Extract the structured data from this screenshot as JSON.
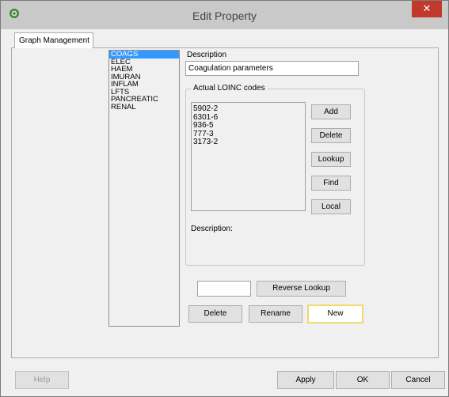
{
  "window": {
    "title": "Edit Property",
    "close_glyph": "✕"
  },
  "tab": {
    "label": "Graph Management"
  },
  "groups": {
    "items": [
      "COAGS",
      "ELEC",
      "HAEM",
      "IMURAN",
      "INFLAM",
      "LFTS",
      "PANCREATIC",
      "RENAL"
    ],
    "selected": "COAGS"
  },
  "description": {
    "label": "Description",
    "value": "Coagulation parameters"
  },
  "loinc": {
    "group_title": "Actual LOINC codes",
    "codes": [
      "5902-2",
      "6301-6",
      "936-5",
      "777-3",
      "3173-2"
    ],
    "buttons": {
      "add": "Add",
      "delete": "Delete",
      "lookup": "Lookup",
      "find": "Find",
      "local": "Local"
    },
    "description_label": "Description:"
  },
  "reverse": {
    "input_value": "",
    "button": "Reverse Lookup"
  },
  "group_actions": {
    "delete": "Delete",
    "rename": "Rename",
    "new": "New"
  },
  "footer": {
    "help": "Help",
    "apply": "Apply",
    "ok": "OK",
    "cancel": "Cancel"
  },
  "colors": {
    "selection": "#3399ff",
    "close": "#c0392b",
    "focus_border": "#f2d96b"
  },
  "icons": {
    "app": "app-logo-icon",
    "close": "close-icon"
  }
}
